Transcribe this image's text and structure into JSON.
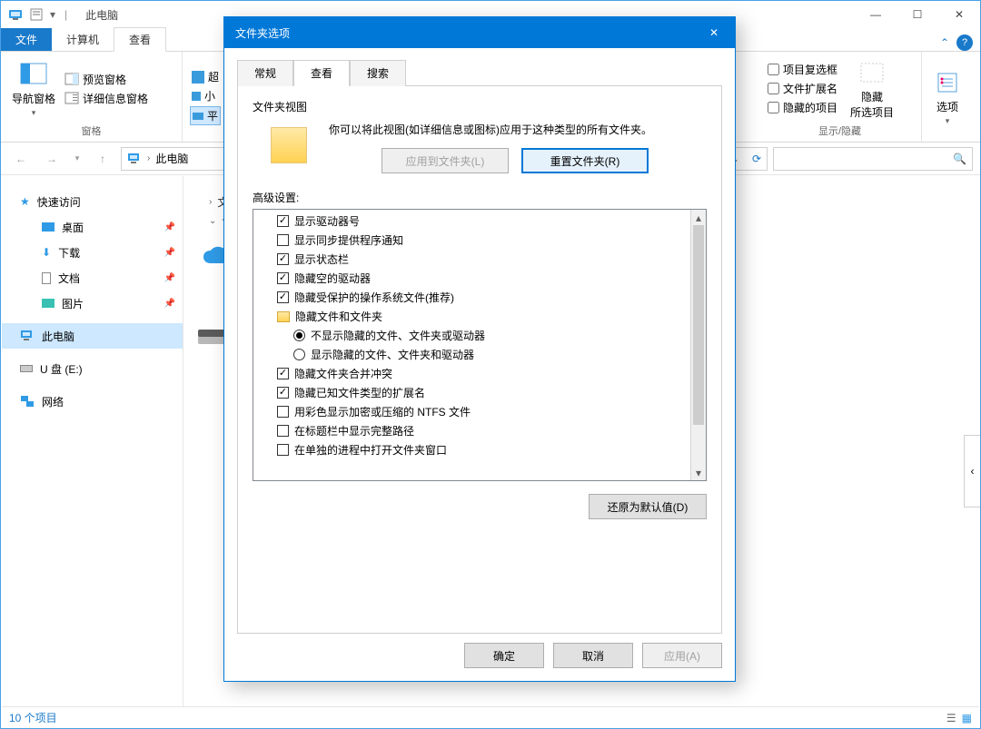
{
  "window": {
    "title": "此电脑",
    "separator": "|",
    "controls": {
      "min": "—",
      "max": "☐",
      "close": "✕"
    }
  },
  "ribbon": {
    "tabs": {
      "file": "文件",
      "computer": "计算机",
      "view": "查看"
    },
    "collapse_icon": "⌃",
    "help": "?",
    "panes": {
      "nav": "导航窗格",
      "preview": "预览窗格",
      "details": "详细信息窗格",
      "group_label": "窗格"
    },
    "layout": {
      "extra_large": "超",
      "small": "小",
      "tiles": "平"
    },
    "right_group": {
      "checkboxes": "项目复选框",
      "extensions": "文件扩展名",
      "hidden_items": "隐藏的项目",
      "hide_selected": "隐藏\n所选项目",
      "options": "选项",
      "group_label": "显示/隐藏"
    }
  },
  "addressbar": {
    "location": "此电脑"
  },
  "navpane": {
    "quick_access": "快速访问",
    "desktop": "桌面",
    "downloads": "下载",
    "documents": "文档",
    "pictures": "图片",
    "this_pc": "此电脑",
    "usb": "U 盘 (E:)",
    "network": "网络"
  },
  "list": {
    "group_folders": "文",
    "group_devices": "设"
  },
  "statusbar": {
    "items": "10 个项目"
  },
  "dialog": {
    "title": "文件夹选项",
    "tabs": {
      "general": "常规",
      "view": "查看",
      "search": "搜索"
    },
    "folder_views": {
      "title": "文件夹视图",
      "desc": "你可以将此视图(如详细信息或图标)应用于这种类型的所有文件夹。",
      "apply": "应用到文件夹(L)",
      "reset": "重置文件夹(R)"
    },
    "advanced": {
      "label": "高级设置:",
      "items": [
        {
          "type": "check",
          "checked": true,
          "label": "显示驱动器号"
        },
        {
          "type": "check",
          "checked": false,
          "label": "显示同步提供程序通知"
        },
        {
          "type": "check",
          "checked": true,
          "label": "显示状态栏"
        },
        {
          "type": "check",
          "checked": true,
          "label": "隐藏空的驱动器"
        },
        {
          "type": "check",
          "checked": true,
          "label": "隐藏受保护的操作系统文件(推荐)"
        },
        {
          "type": "folder",
          "label": "隐藏文件和文件夹"
        },
        {
          "type": "radio",
          "checked": true,
          "level": 2,
          "label": "不显示隐藏的文件、文件夹或驱动器"
        },
        {
          "type": "radio",
          "checked": false,
          "level": 2,
          "label": "显示隐藏的文件、文件夹和驱动器"
        },
        {
          "type": "check",
          "checked": true,
          "label": "隐藏文件夹合并冲突"
        },
        {
          "type": "check",
          "checked": true,
          "label": "隐藏已知文件类型的扩展名"
        },
        {
          "type": "check",
          "checked": false,
          "label": "用彩色显示加密或压缩的 NTFS 文件"
        },
        {
          "type": "check",
          "checked": false,
          "label": "在标题栏中显示完整路径"
        },
        {
          "type": "check",
          "checked": false,
          "label": "在单独的进程中打开文件夹窗口"
        }
      ],
      "restore": "还原为默认值(D)"
    },
    "buttons": {
      "ok": "确定",
      "cancel": "取消",
      "apply": "应用(A)"
    }
  }
}
